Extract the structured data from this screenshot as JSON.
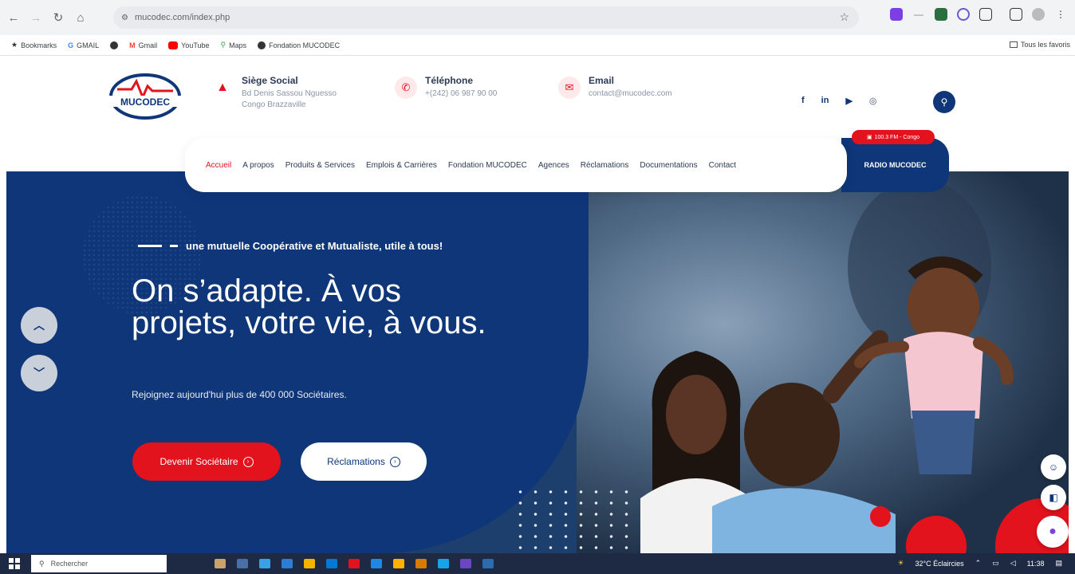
{
  "browser": {
    "url": "mucodec.com/index.php",
    "bookmarks": [
      "Bookmarks",
      "GMAIL",
      "Gmail",
      "YouTube",
      "Maps",
      "Fondation MUCODEC"
    ],
    "bookmarks_right": "Tous les favoris"
  },
  "header": {
    "logo_text": "MUCODEC",
    "siege": {
      "title": "Siège Social",
      "line1": "Bd Denis Sassou Nguesso",
      "line2": "Congo Brazzaville"
    },
    "phone": {
      "title": "Téléphone",
      "value": "+(242) 06 987 90 00"
    },
    "email": {
      "title": "Email",
      "value": "contact@mucodec.com"
    },
    "socials": [
      "f",
      "in",
      "▶",
      "◎"
    ]
  },
  "nav": {
    "items": [
      "Accueil",
      "A propos",
      "Produits & Services",
      "Emplois & Carrières",
      "Fondation MUCODEC",
      "Agences",
      "Réclamations",
      "Documentations",
      "Contact"
    ],
    "radio_label": "RADIO MUCODEC",
    "radio_badge": "100.3 FM - Congo"
  },
  "hero": {
    "tagline": "une mutuelle Coopérative et Mutualiste, utile à tous!",
    "headline": "On s’adapte. À vos projets, votre vie, à vous.",
    "subline": "Rejoignez aujourd'hui plus de 400 000 Sociétaires.",
    "cta_primary": "Devenir Sociétaire",
    "cta_secondary": "Réclamations"
  },
  "taskbar": {
    "search_placeholder": "Rechercher",
    "weather": "32°C Éclaircies",
    "time": "11:38"
  },
  "colors": {
    "brand_blue": "#0e3678",
    "brand_red": "#e3131d"
  }
}
